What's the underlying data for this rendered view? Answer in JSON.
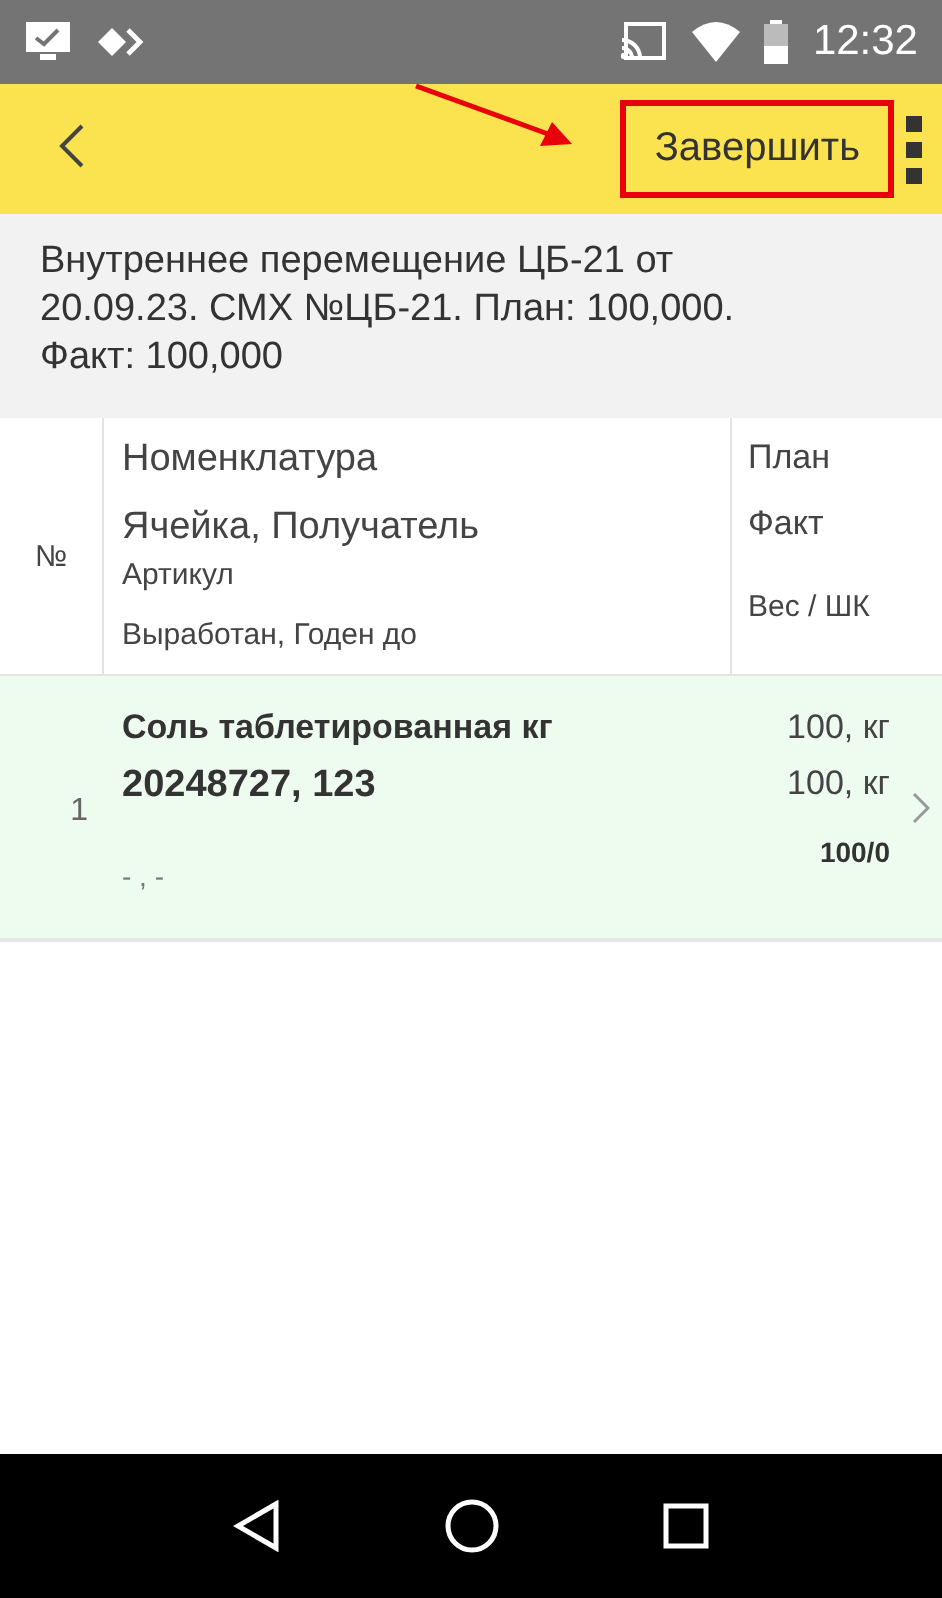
{
  "status_bar": {
    "time": "12:32"
  },
  "toolbar": {
    "finish_button": {
      "label": "Завершить",
      "highlighted": true
    }
  },
  "document": {
    "title": "Внутреннее перемещение ЦБ-21 от 20.09.23. СМХ №ЦБ-21. План: 100,000. Факт: 100,000"
  },
  "table": {
    "columns": {
      "number": "№",
      "item_lines": [
        "Номенклатура",
        "Ячейка, Получатель",
        "Артикул",
        "Выработан, Годен до"
      ],
      "qty_lines": [
        "План",
        "Факт",
        "Вес / ШК"
      ]
    },
    "rows": [
      {
        "number": "1",
        "name": "Соль таблетированная кг",
        "cell": "20248727, 123",
        "dates": "- , -",
        "plan": "100, кг",
        "fact": "100, кг",
        "weight": "100/0",
        "selected": true
      }
    ]
  }
}
